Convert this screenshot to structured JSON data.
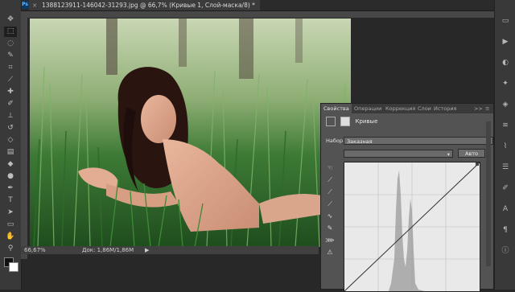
{
  "app": {
    "logo": "Ps"
  },
  "document": {
    "tab_title": "1388123911-146042-31293.jpg @ 66,7% (Кривые 1, Слой-маска/8) *",
    "close": "×"
  },
  "status": {
    "zoom": "66,67%",
    "doc_info": "Док: 1,86M/1,86M",
    "arrow": "▶"
  },
  "tools": [
    {
      "icon": "move-icon",
      "glyph": "✥"
    },
    {
      "icon": "marquee-icon",
      "glyph": "⬚"
    },
    {
      "icon": "lasso-icon",
      "glyph": "◌"
    },
    {
      "icon": "quick-select-icon",
      "glyph": "✎"
    },
    {
      "icon": "crop-icon",
      "glyph": "⌗"
    },
    {
      "icon": "eyedropper-icon",
      "glyph": "⟋"
    },
    {
      "icon": "healing-icon",
      "glyph": "✚"
    },
    {
      "icon": "brush-icon",
      "glyph": "✐"
    },
    {
      "icon": "stamp-icon",
      "glyph": "⊥"
    },
    {
      "icon": "history-brush-icon",
      "glyph": "↺"
    },
    {
      "icon": "eraser-icon",
      "glyph": "◇"
    },
    {
      "icon": "gradient-icon",
      "glyph": "▤"
    },
    {
      "icon": "blur-icon",
      "glyph": "◆"
    },
    {
      "icon": "dodge-icon",
      "glyph": "●"
    },
    {
      "icon": "pen-icon",
      "glyph": "✒"
    },
    {
      "icon": "type-icon",
      "glyph": "T"
    },
    {
      "icon": "path-select-icon",
      "glyph": "➤"
    },
    {
      "icon": "shape-icon",
      "glyph": "▭"
    },
    {
      "icon": "hand-icon",
      "glyph": "✋"
    },
    {
      "icon": "zoom-icon",
      "glyph": "⚲"
    }
  ],
  "panel": {
    "tabs": [
      "Свойства",
      "Операции",
      "Коррекция",
      "Слои",
      "История"
    ],
    "tab_more": ">>",
    "menu": "≡",
    "header_title": "Кривые",
    "preset_label": "Набор:",
    "preset_value": "Заказная",
    "channel_value": "",
    "auto_button": "Авто",
    "curve_tools": [
      {
        "icon": "target-adjust-icon",
        "glyph": "☜"
      },
      {
        "icon": "black-point-eyedropper-icon",
        "glyph": "⟋"
      },
      {
        "icon": "gray-point-eyedropper-icon",
        "glyph": "⟋"
      },
      {
        "icon": "white-point-eyedropper-icon",
        "glyph": "⟋"
      },
      {
        "icon": "curve-edit-icon",
        "glyph": "∿"
      },
      {
        "icon": "pencil-draw-icon",
        "glyph": "✎"
      },
      {
        "icon": "smooth-icon",
        "glyph": "⋙"
      },
      {
        "icon": "clipping-warning-icon",
        "glyph": "⚠"
      }
    ]
  },
  "right_icons": [
    {
      "icon": "history-panel-icon",
      "glyph": "▭"
    },
    {
      "icon": "actions-panel-icon",
      "glyph": "▶"
    },
    {
      "icon": "adjustments-panel-icon",
      "glyph": "◐"
    },
    {
      "icon": "styles-panel-icon",
      "glyph": "✦"
    },
    {
      "icon": "layers-panel-icon",
      "glyph": "◈"
    },
    {
      "icon": "channels-panel-icon",
      "glyph": "≋"
    },
    {
      "icon": "paths-panel-icon",
      "glyph": "⌇"
    },
    {
      "icon": "properties-panel-icon",
      "glyph": "☰"
    },
    {
      "icon": "brush-panel-icon",
      "glyph": "✐"
    },
    {
      "icon": "character-panel-icon",
      "glyph": "A"
    },
    {
      "icon": "paragraph-panel-icon",
      "glyph": "¶"
    },
    {
      "icon": "info-panel-icon",
      "glyph": "ⓘ"
    }
  ],
  "colors": {
    "panel_bg": "#535353",
    "ui_bg": "#282828",
    "photo_grass": "#2f6e2a"
  }
}
